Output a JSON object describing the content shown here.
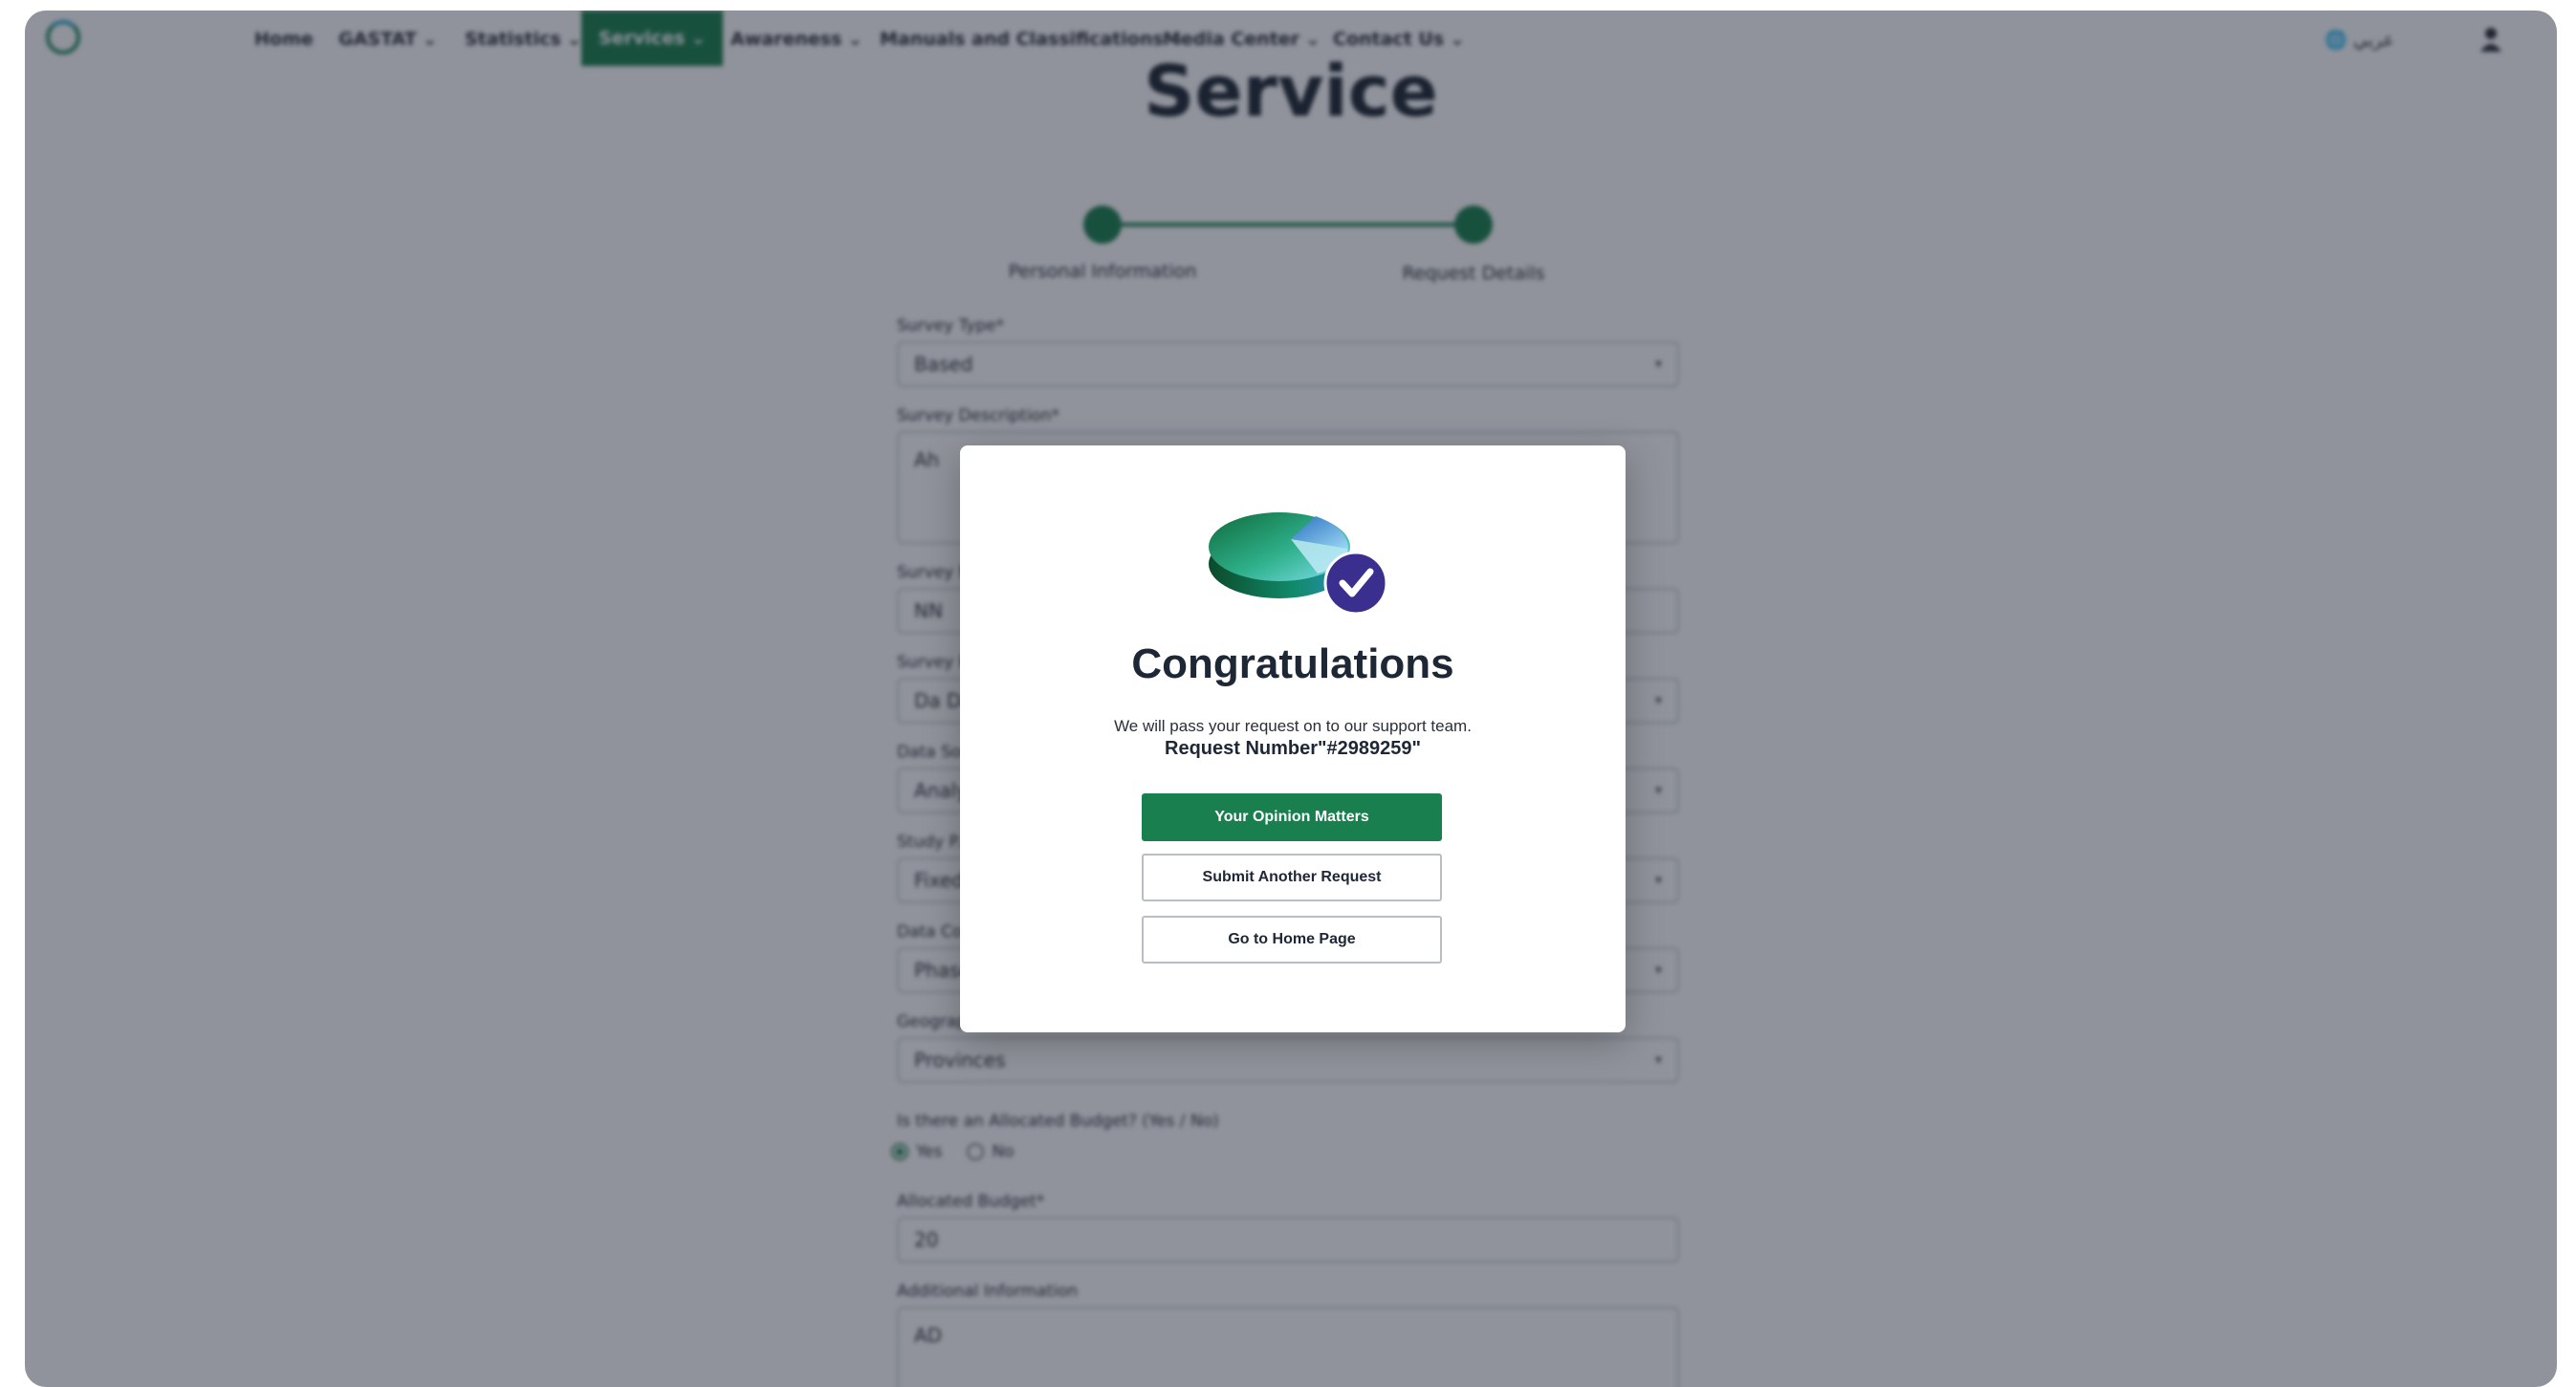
{
  "nav": {
    "logo_text": "",
    "items": [
      {
        "label": "Home"
      },
      {
        "label": "GASTAT"
      },
      {
        "label": "Statistics"
      },
      {
        "label": "Services"
      },
      {
        "label": "Awareness"
      },
      {
        "label": "Manuals and Classifications"
      },
      {
        "label": "Media Center"
      },
      {
        "label": "Contact Us"
      }
    ],
    "language": "عربي"
  },
  "page": {
    "title": "Service",
    "steps": [
      {
        "label": "Personal Information"
      },
      {
        "label": "Request Details"
      }
    ],
    "form": {
      "fields": [
        {
          "label": "Survey Type*",
          "value": "Based"
        },
        {
          "label": "Survey Description*",
          "value": "Ah"
        },
        {
          "label": "Survey N...",
          "value": "NN"
        },
        {
          "label": "Survey P...",
          "value": "Da Da"
        },
        {
          "label": "Data Sou...",
          "value": "Analy"
        },
        {
          "label": "Study P...",
          "value": "Fixed"
        },
        {
          "label": "Data Col...",
          "value": "Phase"
        },
        {
          "label": "Geograph...",
          "value": "Provinces"
        }
      ],
      "budget_question": "Is there an Allocated Budget? (Yes / No)",
      "radio_yes": "Yes",
      "radio_no": "No",
      "allocated_budget_label": "Allocated Budget*",
      "allocated_budget_value": "20",
      "additional_info_label": "Additional Information",
      "additional_info_value": "AD"
    }
  },
  "modal": {
    "title": "Congratulations",
    "message": "We will pass your request on to our support team.",
    "request_number": "Request Number\"#2989259\"",
    "buttons": {
      "opinion": "Your Opinion Matters",
      "another": "Submit Another Request",
      "home": "Go to Home Page"
    }
  },
  "colors": {
    "brand_green": "#1a7f4e",
    "overlay": "rgba(22,30,46,0.48)",
    "check_badge": "#3a2f8f"
  }
}
